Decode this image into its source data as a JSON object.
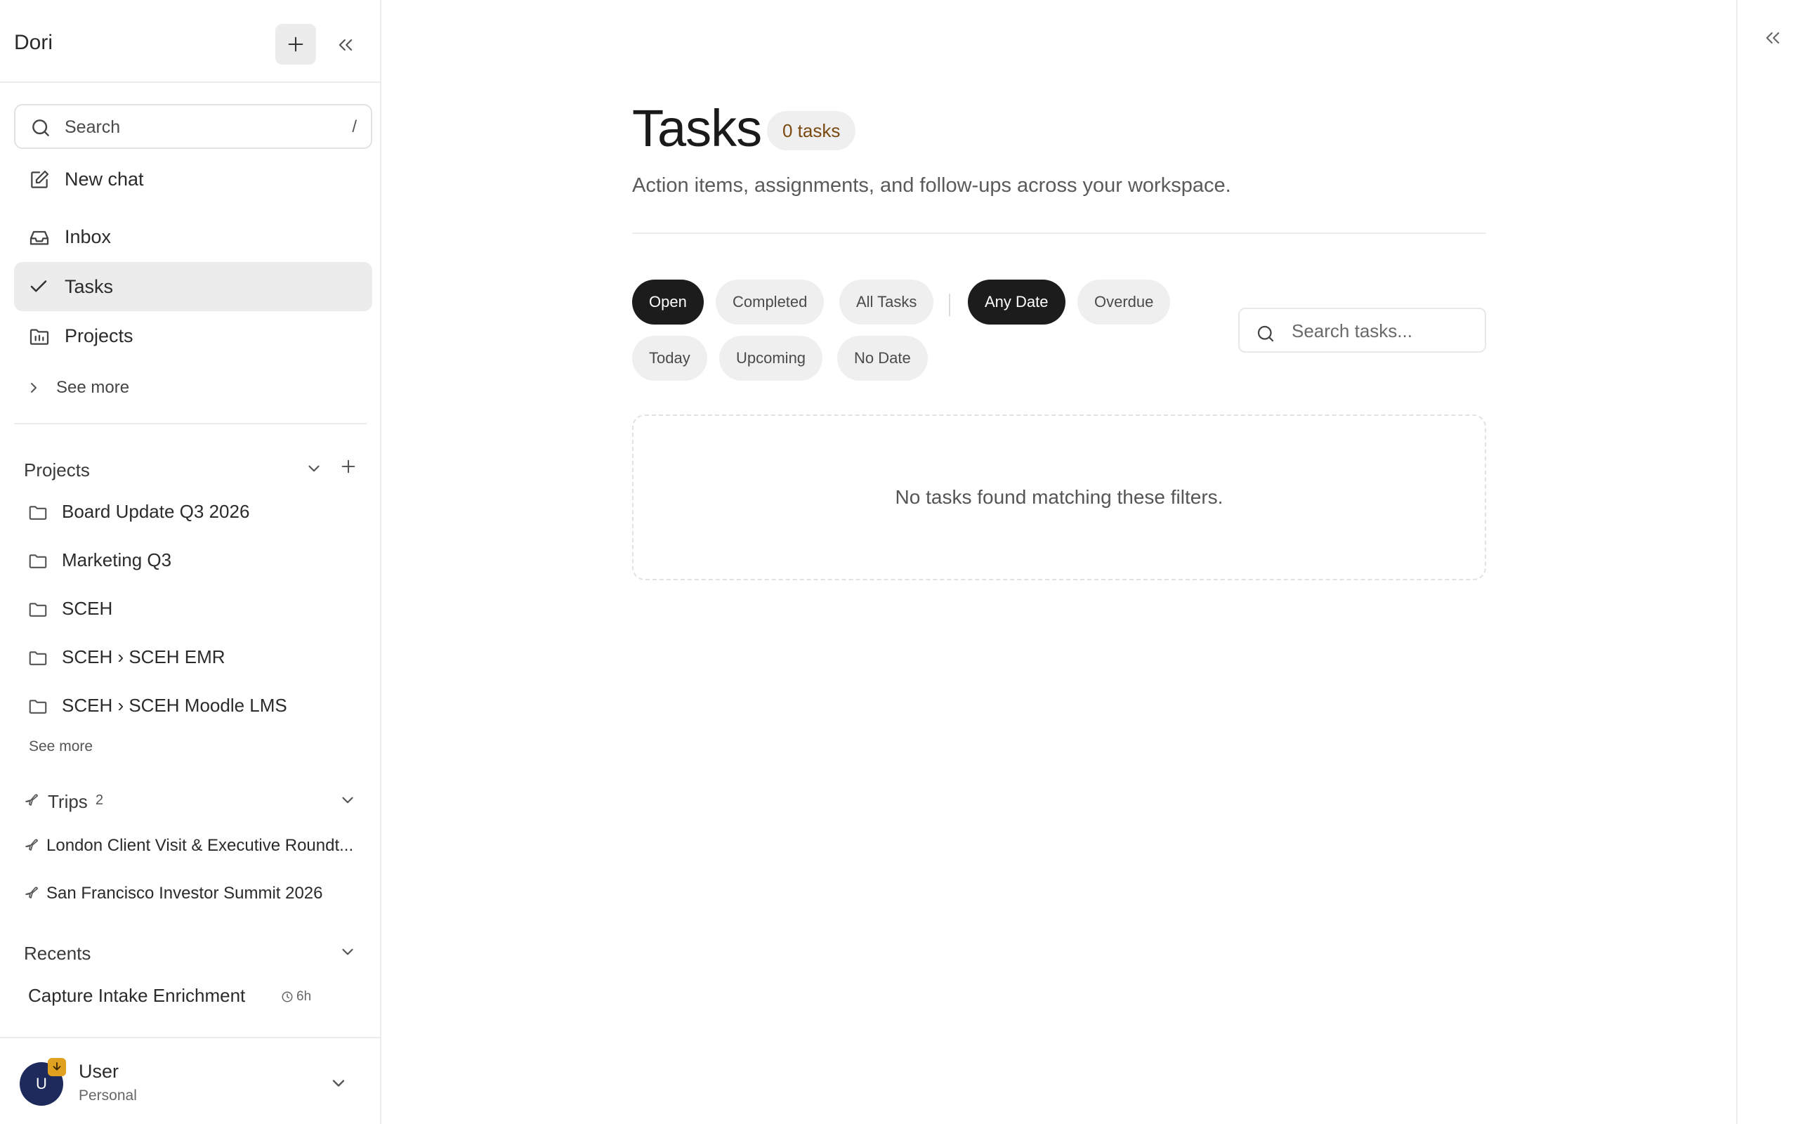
{
  "sidebar": {
    "brand": "Dori",
    "search": {
      "placeholder": "Search",
      "shortcut": "/"
    },
    "nav": {
      "new_chat": "New chat",
      "inbox": "Inbox",
      "tasks": "Tasks",
      "projects": "Projects",
      "see_more": "See more"
    },
    "projects_section": {
      "title": "Projects",
      "items": [
        "Board Update Q3 2026",
        "Marketing Q3",
        "SCEH",
        "SCEH › SCEH EMR",
        "SCEH › SCEH Moodle LMS"
      ],
      "see_more": "See more"
    },
    "trips_section": {
      "title": "Trips",
      "count": "2",
      "items": [
        "London Client Visit & Executive Roundt...",
        "San Francisco Investor Summit 2026"
      ]
    },
    "recents_section": {
      "title": "Recents",
      "items": [
        {
          "label": "Capture Intake Enrichment",
          "age": "6h"
        }
      ]
    },
    "user": {
      "initial": "U",
      "name": "User",
      "plan": "Personal"
    }
  },
  "main": {
    "title": "Tasks",
    "count_badge": "0 tasks",
    "subtitle": "Action items, assignments, and follow-ups across your workspace.",
    "status_filters": [
      {
        "label": "Open",
        "active": true
      },
      {
        "label": "Completed",
        "active": false
      },
      {
        "label": "All Tasks",
        "active": false
      }
    ],
    "date_filters": [
      {
        "label": "Any Date",
        "active": true
      },
      {
        "label": "Overdue",
        "active": false
      },
      {
        "label": "Today",
        "active": false
      },
      {
        "label": "Upcoming",
        "active": false
      },
      {
        "label": "No Date",
        "active": false
      }
    ],
    "search_placeholder": "Search tasks...",
    "empty_message": "No tasks found matching these filters."
  },
  "colors": {
    "accent_dark": "#1c1c1c",
    "chip_bg": "#efefef",
    "badge_text": "#7a4a10",
    "avatar_bg": "#1e2a5c",
    "avatar_badge": "#e0a020"
  }
}
